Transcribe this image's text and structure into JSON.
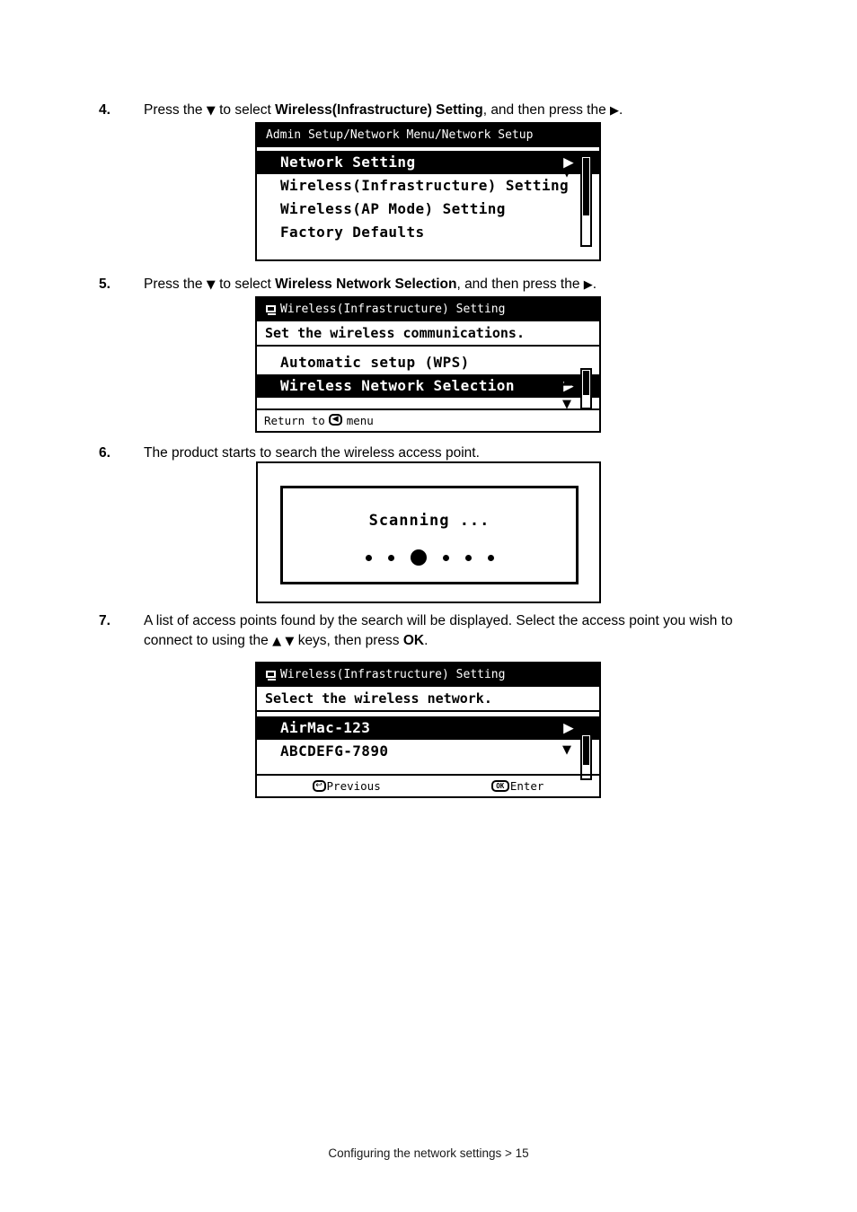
{
  "document": {
    "footer": "Configuring the network settings > 15"
  },
  "steps": [
    {
      "number": "4.",
      "text_before": "Press the",
      "down_arrow": "▼",
      "text_mid": "to select",
      "bold": "Wireless(Infrastructure) Setting",
      "text_after": ", and then press the",
      "right_arrow": "▶",
      "text_end": "."
    },
    {
      "number": "5.",
      "text_before": "Press the",
      "down_arrow": "▼",
      "text_mid": "to select",
      "bold": "Wireless Network Selection",
      "text_after": ", and then press the",
      "right_arrow": "▶",
      "text_end": "."
    },
    {
      "number": "6.",
      "text": "The product starts to search the wireless access point."
    },
    {
      "number": "7.",
      "text_before": "A list of access points found by the search will be displayed. Select the access point you wish to connect to using the",
      "up_arrow": "▲",
      "down_arrow": "▼",
      "text_mid": "keys, then press",
      "bold": "OK",
      "text_end": "."
    }
  ],
  "panels": {
    "network_setup": {
      "title": "Admin Setup/Network Menu/Network Setup",
      "items": [
        {
          "label": "Network Setting",
          "selected": true,
          "arrow": "▶"
        },
        {
          "label": "Wireless(Infrastructure) Setting",
          "selected": false,
          "arrow": ""
        },
        {
          "label": "Wireless(AP Mode) Setting",
          "selected": false,
          "arrow": ""
        },
        {
          "label": "Factory Defaults",
          "selected": false,
          "arrow": ""
        }
      ],
      "scroll_down_caret": "▼"
    },
    "wireless_setting": {
      "title": "Wireless(Infrastructure) Setting",
      "title_icon": "display-icon",
      "subtitle": "Set the wireless communications.",
      "items": [
        {
          "label": "Automatic setup (WPS)",
          "selected": false,
          "arrow": ""
        },
        {
          "label": "Wireless Network Selection",
          "selected": true,
          "arrow": "▶"
        }
      ],
      "scroll_up_caret": "▲",
      "scroll_down_caret": "▼",
      "footer_prefix": "Return to",
      "footer_key": "◀",
      "footer_suffix": "menu"
    },
    "scanning": {
      "message": "Scanning ...",
      "dots": [
        {
          "size": "small"
        },
        {
          "size": "small"
        },
        {
          "size": "large"
        },
        {
          "size": "small"
        },
        {
          "size": "small"
        },
        {
          "size": "small"
        }
      ]
    },
    "network_select": {
      "title": "Wireless(Infrastructure) Setting",
      "title_icon": "display-icon",
      "subtitle": "Select the wireless network.",
      "items": [
        {
          "label": "AirMac-123",
          "selected": true,
          "arrow": "▶"
        },
        {
          "label": "ABCDEFG-7890",
          "selected": false,
          "arrow": ""
        }
      ],
      "scroll_down_caret": "▼",
      "footer_left_key": "↩",
      "footer_left": "Previous",
      "footer_right_key": "OK",
      "footer_right": "Enter"
    }
  }
}
